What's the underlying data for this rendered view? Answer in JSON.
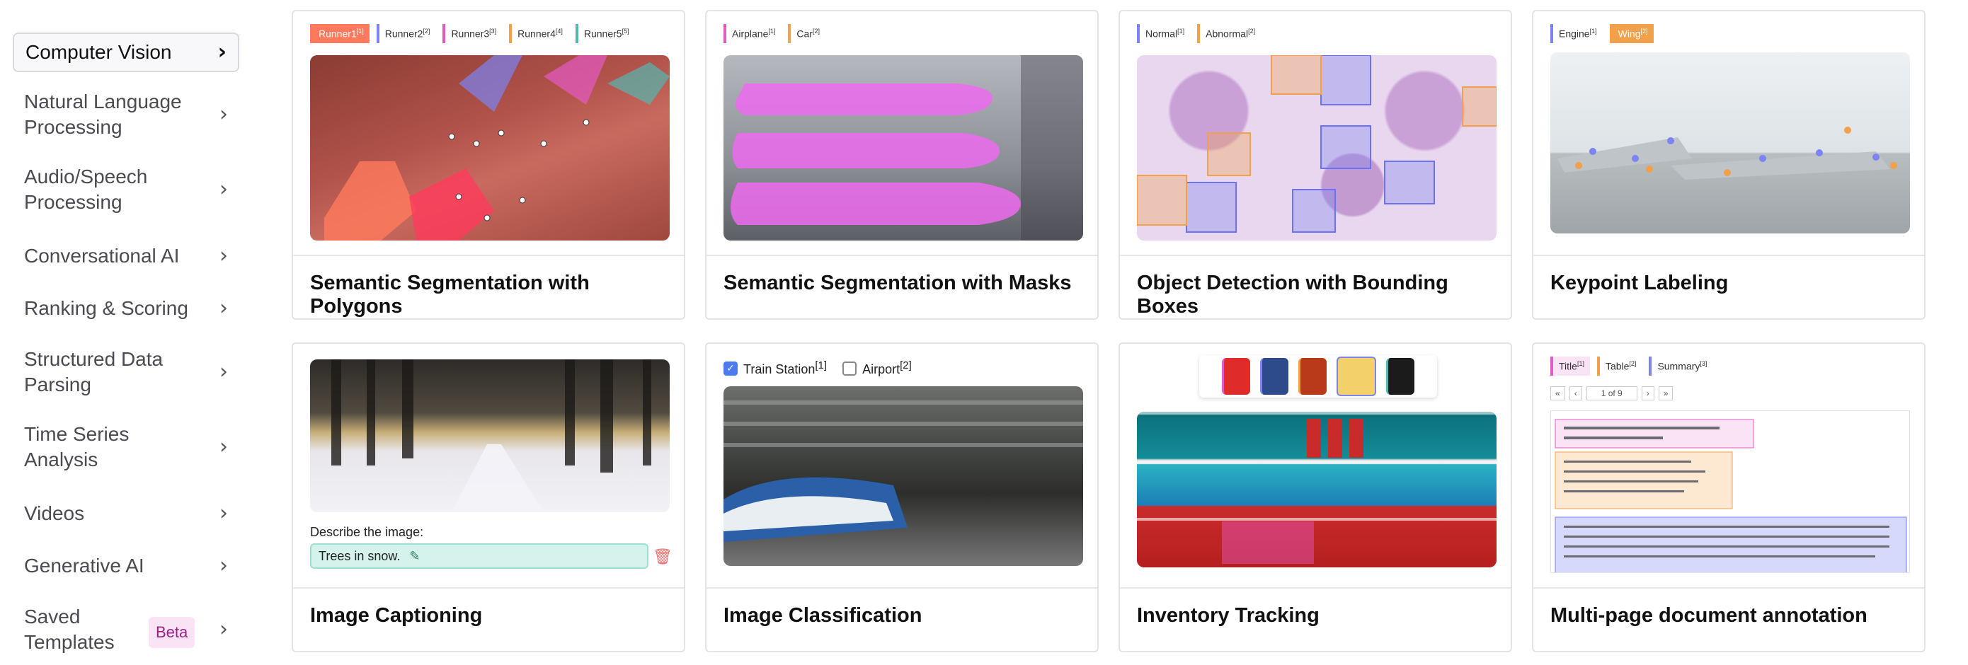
{
  "sidebar": {
    "items": [
      {
        "label": "Computer Vision",
        "active": true
      },
      {
        "label": "Natural Language Processing"
      },
      {
        "label": "Audio/Speech Processing"
      },
      {
        "label": "Conversational AI"
      },
      {
        "label": "Ranking & Scoring"
      },
      {
        "label": "Structured Data Parsing"
      },
      {
        "label": "Time Series Analysis"
      },
      {
        "label": "Videos"
      },
      {
        "label": "Generative AI"
      },
      {
        "label": "Saved Templates",
        "badge": "Beta"
      }
    ]
  },
  "cards": [
    {
      "title": "Semantic Segmentation with Polygons",
      "chips": [
        {
          "label": "Runner1",
          "sup": "[1]",
          "color": "#ff7a5c"
        },
        {
          "label": "Runner2",
          "sup": "[2]",
          "color": "#7c83f2"
        },
        {
          "label": "Runner3",
          "sup": "[3]",
          "color": "#e45ac4"
        },
        {
          "label": "Runner4",
          "sup": "[4]",
          "color": "#f2a04a"
        },
        {
          "label": "Runner5",
          "sup": "[5]",
          "color": "#54b7b0"
        }
      ]
    },
    {
      "title": "Semantic Segmentation with Masks",
      "chips": [
        {
          "label": "Airplane",
          "sup": "[1]",
          "color": "#e45ac4"
        },
        {
          "label": "Car",
          "sup": "[2]",
          "color": "#f2a04a"
        }
      ]
    },
    {
      "title": "Object Detection with Bounding Boxes",
      "chips": [
        {
          "label": "Normal",
          "sup": "[1]",
          "color": "#7c83f2"
        },
        {
          "label": "Abnormal",
          "sup": "[2]",
          "color": "#f2a04a"
        }
      ]
    },
    {
      "title": "Keypoint Labeling",
      "chips": [
        {
          "label": "Engine",
          "sup": "[1]",
          "color": "#7c83f2"
        },
        {
          "label": "Wing",
          "sup": "[2]",
          "color": "#f2a04a"
        }
      ]
    },
    {
      "title": "Image Captioning",
      "caption_label": "Describe the image:",
      "caption_value": "Trees in snow."
    },
    {
      "title": "Image Classification",
      "options": [
        {
          "label": "Train Station",
          "sup": "[1]",
          "checked": true
        },
        {
          "label": "Airport",
          "sup": "[2]",
          "checked": false
        }
      ]
    },
    {
      "title": "Inventory Tracking"
    },
    {
      "title": "Multi-page document annotation",
      "chips": [
        {
          "label": "Title",
          "sup": "[1]",
          "color": "#e45ac4"
        },
        {
          "label": "Table",
          "sup": "[2]",
          "color": "#f2a04a"
        },
        {
          "label": "Summary",
          "sup": "[3]",
          "color": "#7c83f2"
        }
      ],
      "pager": "1 of 9"
    }
  ]
}
